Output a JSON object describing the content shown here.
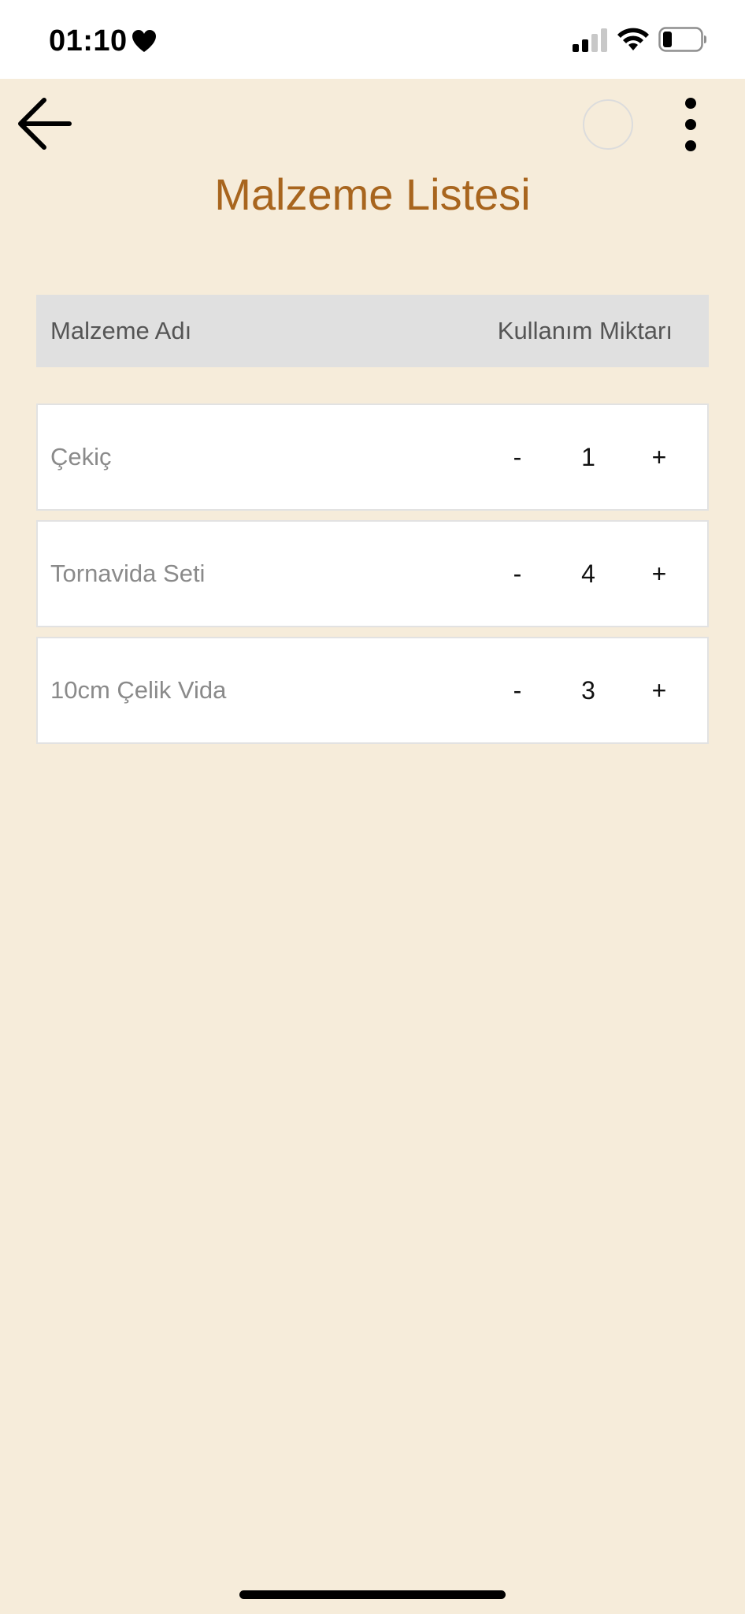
{
  "status_bar": {
    "time": "01:10",
    "icons": [
      "heart-icon",
      "signal-icon",
      "wifi-icon",
      "battery-icon"
    ]
  },
  "app_bar": {
    "back_icon": "arrow-left-icon",
    "more_icon": "more-vertical-icon"
  },
  "page": {
    "title": "Malzeme Listesi"
  },
  "table": {
    "header": {
      "name_label": "Malzeme Adı",
      "qty_label": "Kullanım Miktarı"
    },
    "rows": [
      {
        "name": "Çekiç",
        "minus_label": "-",
        "quantity": "1",
        "plus_label": "+"
      },
      {
        "name": "Tornavida Seti",
        "minus_label": "-",
        "quantity": "4",
        "plus_label": "+"
      },
      {
        "name": "10cm Çelik Vida",
        "minus_label": "-",
        "quantity": "3",
        "plus_label": "+"
      }
    ]
  },
  "colors": {
    "background": "#F6ECDA",
    "title": "#A8651E",
    "header_bg": "#E0E0E0",
    "row_bg": "#FFFFFF"
  }
}
